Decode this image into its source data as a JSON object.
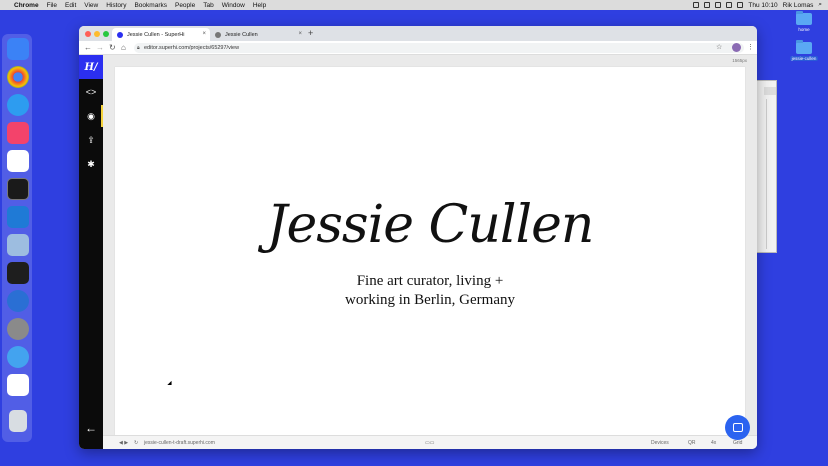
{
  "menubar": {
    "items": [
      "Chrome",
      "File",
      "Edit",
      "View",
      "History",
      "Bookmarks",
      "People",
      "Tab",
      "Window",
      "Help"
    ],
    "clock": "Thu 10:10",
    "user": "Rik Lomas"
  },
  "desktop": {
    "items": [
      {
        "label": "home"
      },
      {
        "label": "jessie-cullen"
      }
    ]
  },
  "dock": {
    "apps": [
      "finder-icon",
      "chrome-icon",
      "messages-icon",
      "music-icon",
      "slack-icon",
      "terminal-icon",
      "vscode-icon",
      "preview-icon",
      "figma-icon",
      "tower-icon",
      "photo-icon",
      "tweetbot-icon",
      "ia-writer-icon",
      "trash-icon"
    ]
  },
  "browser": {
    "tabs": [
      {
        "label": "Jessie Cullen - SuperHi"
      },
      {
        "label": "Jessie Cullen"
      }
    ],
    "url": "editor.superhi.com/projects/65297/view"
  },
  "editor": {
    "sidebar_logo": "H/",
    "canvas_size": "1565px",
    "status_url": "jessie-cullen-t-draft.superhi.com",
    "status_items": [
      "Devices",
      "QR",
      "4x",
      "Grid"
    ]
  },
  "page": {
    "title": "Jessie Cullen",
    "subtitle_line1": "Fine art curator, living +",
    "subtitle_line2": "working in Berlin, Germany"
  },
  "colors": {
    "desktop": "#2f3fe0",
    "accent": "#2b2ff0",
    "sidebar": "#0b0b0b",
    "active_marker": "#f5d33c"
  }
}
